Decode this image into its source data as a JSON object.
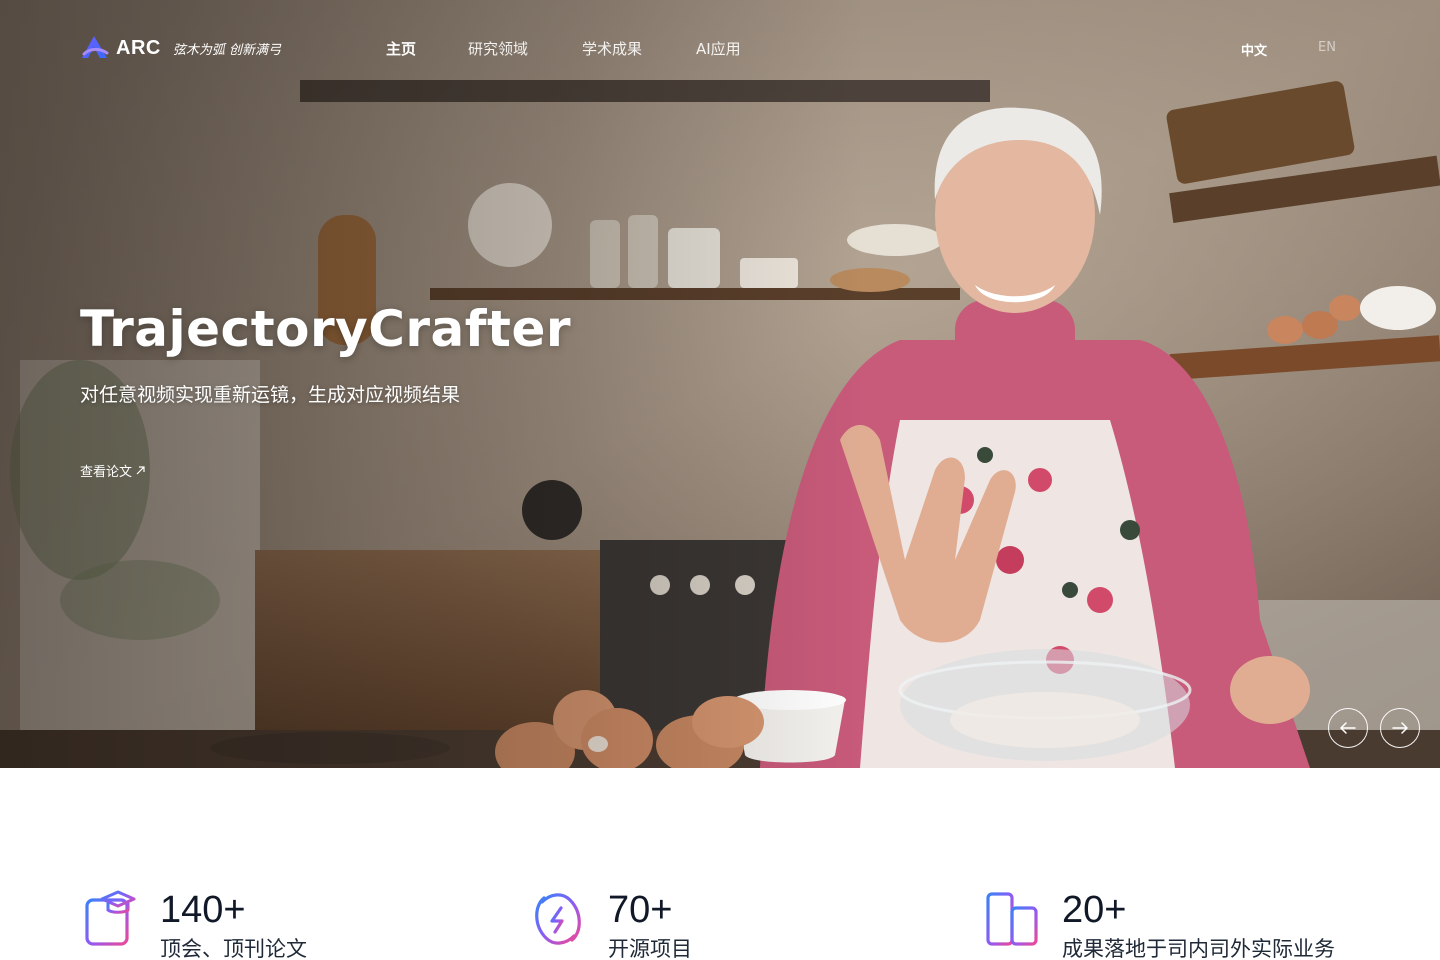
{
  "brand": {
    "name": "ARC",
    "slogan": "弦木为弧 创新满弓"
  },
  "nav": {
    "items": [
      {
        "label": "主页",
        "active": true
      },
      {
        "label": "研究领域",
        "active": false
      },
      {
        "label": "学术成果",
        "active": false
      },
      {
        "label": "AI应用",
        "active": false
      }
    ],
    "languages": [
      {
        "label": "中文",
        "active": true
      },
      {
        "label": "EN",
        "active": false
      }
    ]
  },
  "hero": {
    "title": "TrajectoryCrafter",
    "subtitle": "对任意视频实现重新运镜，生成对应视频结果",
    "link_label": "查看论文",
    "link_icon": "arrow-up-right-icon"
  },
  "carousel": {
    "prev_icon": "arrow-left-icon",
    "next_icon": "arrow-right-icon"
  },
  "stats": [
    {
      "value": "140+",
      "label": "顶会、顶刊论文",
      "icon": "paper-graduation-cap-icon"
    },
    {
      "value": "70+",
      "label": "开源项目",
      "icon": "open-source-link-icon"
    },
    {
      "value": "20+",
      "label": "成果落地于司内司外实际业务",
      "icon": "buildings-icon"
    }
  ],
  "colors": {
    "gradient_start": "#3b82f6",
    "gradient_mid": "#8b5cf6",
    "gradient_end": "#ec4899",
    "text_dark": "#111827"
  }
}
